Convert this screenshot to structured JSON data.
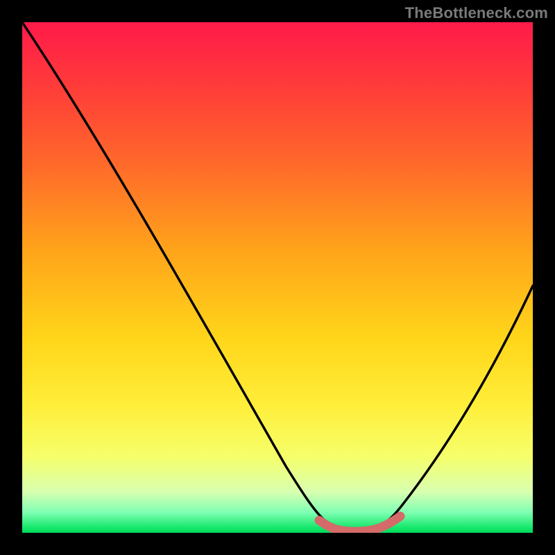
{
  "watermark": {
    "text": "TheBottleneck.com"
  },
  "chart_data": {
    "type": "line",
    "title": "",
    "xlabel": "",
    "ylabel": "",
    "xlim": [
      0,
      100
    ],
    "ylim": [
      0,
      100
    ],
    "series": [
      {
        "name": "curve",
        "x": [
          0,
          8,
          15,
          22,
          30,
          38,
          45,
          52,
          58,
          62,
          66,
          70,
          74,
          78,
          82,
          88,
          94,
          100
        ],
        "values": [
          100,
          89,
          78,
          67,
          55,
          42,
          30,
          18,
          8,
          3,
          1,
          1,
          1,
          3,
          8,
          18,
          32,
          48
        ]
      }
    ],
    "legend": false,
    "grid": false,
    "background": "vertical-gradient-red-to-green",
    "annotations": [
      {
        "text": "TheBottleneck.com",
        "pos": "top-right"
      }
    ]
  },
  "colors": {
    "curve": "#000000",
    "highlight": "#d46a6a",
    "frame": "#000000"
  }
}
